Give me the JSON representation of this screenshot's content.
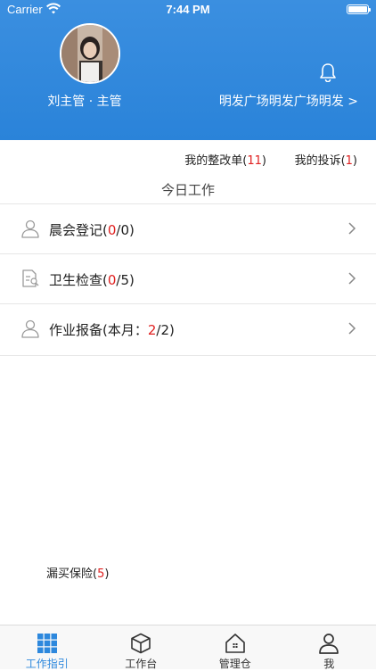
{
  "status_bar": {
    "carrier": "Carrier",
    "time": "7:44 PM"
  },
  "header": {
    "user_name": "刘主管 · 主管",
    "location": "明发广场明发广场明发 >",
    "accent_color": "#2d88dd"
  },
  "links": {
    "rectification_prefix": "我的整改单(",
    "rectification_count": "11",
    "rectification_suffix": ")",
    "complaint_prefix": "我的投诉(",
    "complaint_count": "1",
    "complaint_suffix": ")"
  },
  "today": {
    "title": "今日工作",
    "rows": [
      {
        "icon": "user-icon",
        "prefix": "晨会登记(",
        "done": "0",
        "suffix": "/0)"
      },
      {
        "icon": "clipboard-icon",
        "prefix": "卫生检查(",
        "done": "0",
        "suffix": "/5)"
      },
      {
        "icon": "user-icon",
        "prefix": "作业报备(本月：",
        "done": "2",
        "suffix": "/2)"
      }
    ]
  },
  "insurance": {
    "prefix": "漏买保险(",
    "count": "5",
    "suffix": ")"
  },
  "tabbar": {
    "tabs": [
      {
        "label": "工作指引",
        "icon": "grid-icon",
        "active": true
      },
      {
        "label": "工作台",
        "icon": "box-icon",
        "active": false
      },
      {
        "label": "管理仓",
        "icon": "house-icon",
        "active": false
      },
      {
        "label": "我",
        "icon": "person-icon",
        "active": false
      }
    ]
  }
}
